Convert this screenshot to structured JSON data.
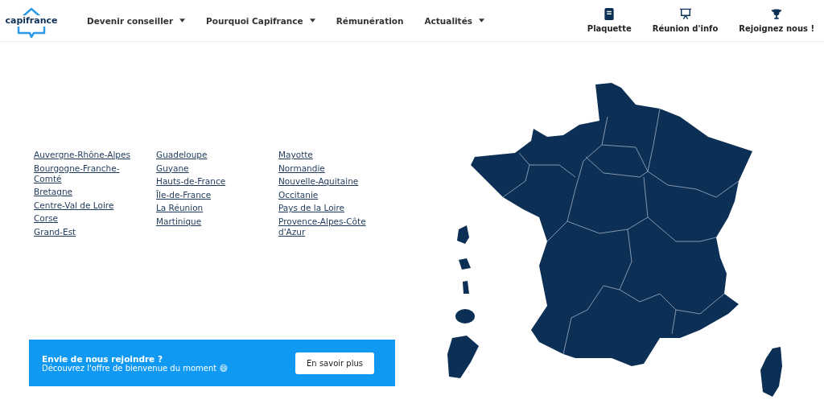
{
  "header": {
    "logo": "capifrance",
    "nav": [
      {
        "label": "Devenir conseiller",
        "dropdown": true
      },
      {
        "label": "Pourquoi Capifrance",
        "dropdown": true
      },
      {
        "label": "Rémunération",
        "dropdown": false
      },
      {
        "label": "Actualités",
        "dropdown": true
      }
    ],
    "actions": [
      {
        "label": "Plaquette",
        "kind": "book"
      },
      {
        "label": "Réunion d'info",
        "kind": "presentation"
      },
      {
        "label": "Rejoignez nous !",
        "kind": "trophy"
      }
    ]
  },
  "regions": [
    [
      "Auvergne-Rhône-Alpes",
      "Bourgogne-Franche-Comté",
      "Bretagne",
      "Centre-Val de Loire",
      "Corse",
      "Grand-Est"
    ],
    [
      "Guadeloupe",
      "Guyane",
      "Hauts-de-France",
      "Île-de-France",
      "La Réunion",
      "Martinique"
    ],
    [
      "Mayotte",
      "Normandie",
      "Nouvelle-Aquitaine",
      "Occitanie",
      "Pays de la Loire",
      "Provence-Alpes-Côte d'Azur"
    ]
  ],
  "banner": {
    "title": "Envie de nous rejoindre ?",
    "text": "Découvrez l'offre de bienvenue du moment 😄",
    "button": "En savoir plus"
  }
}
